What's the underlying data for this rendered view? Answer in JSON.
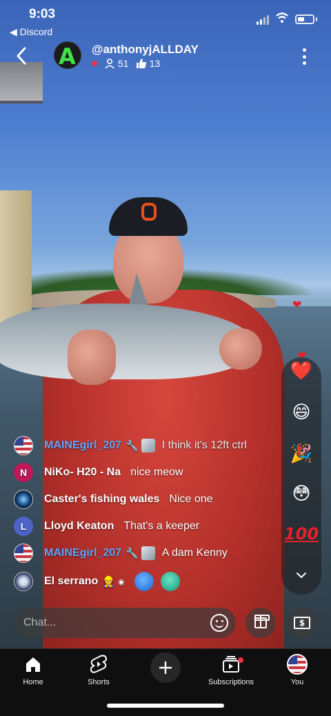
{
  "status_bar": {
    "time": "9:03",
    "back_app": "◀ Discord"
  },
  "channel": {
    "name": "@anthonyjALLDAY",
    "viewers": "51",
    "likes": "13",
    "avatar_letter": "A"
  },
  "floating_hearts": [
    "❤",
    "❤"
  ],
  "reactions": [
    "❤️",
    "😄",
    "🎉",
    "😳",
    "100"
  ],
  "chat": [
    {
      "author": "MAINEgirl_207",
      "author_style": "mod",
      "avatar": "flag",
      "badges": [
        "wrench",
        "image"
      ],
      "text": "I think it's 12ft ctrl"
    },
    {
      "author": "NiKo- H20 - Na",
      "author_style": "normal",
      "avatar": "N",
      "badges": [],
      "text": "nice meow"
    },
    {
      "author": "Caster's fishing wales",
      "author_style": "normal",
      "avatar": "earth",
      "badges": [],
      "text": "Nice one"
    },
    {
      "author": "Lloyd Keaton",
      "author_style": "normal",
      "avatar": "L",
      "badges": [],
      "text": "That's a keeper"
    },
    {
      "author": "MAINEgirl_207",
      "author_style": "mod",
      "avatar": "flag",
      "badges": [
        "wrench",
        "image"
      ],
      "text": "A dam Kenny"
    },
    {
      "author": "El serrano",
      "author_style": "normal",
      "avatar": "team",
      "badges": [
        "person",
        "small"
      ],
      "text": ""
    }
  ],
  "chat_input": {
    "placeholder": "Chat..."
  },
  "buttons": {
    "super_chat": "$"
  },
  "nav": [
    {
      "label": "Home",
      "icon": "home-icon"
    },
    {
      "label": "Shorts",
      "icon": "shorts-icon"
    },
    {
      "label": "",
      "icon": "create-icon"
    },
    {
      "label": "Subscriptions",
      "icon": "subscriptions-icon"
    },
    {
      "label": "You",
      "icon": "you-avatar"
    }
  ],
  "colors": {
    "mod_author": "#5ba7ff",
    "live_dot": "#f03246",
    "nav_bg": "#0f0f0f"
  }
}
